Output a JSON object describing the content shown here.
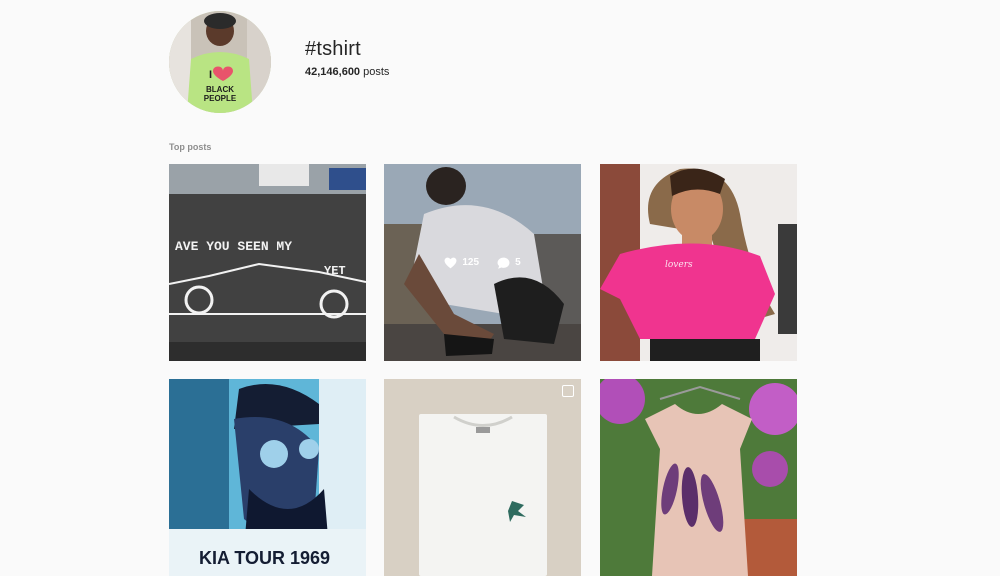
{
  "header": {
    "hashtag": "#tshirt",
    "post_count": "42,146,600",
    "post_count_suffix": " posts"
  },
  "avatar": {
    "shirt_text_1": "I",
    "shirt_text_2": "BLACK",
    "shirt_text_3": "PEOPLE"
  },
  "sections": {
    "top_posts": "Top posts"
  },
  "posts": [
    {
      "caption_art": [
        "AVE YOU SEEN MY",
        "YET"
      ]
    },
    {
      "likes": "125",
      "comments": "5"
    },
    {
      "shirt_script": "lovers"
    },
    {
      "shirt_text": "KIA TOUR 1969"
    },
    {},
    {}
  ],
  "colors": {
    "background": "#fafafa",
    "muted": "#8e8e8e",
    "text": "#262626",
    "pink_shirt": "#f0348f"
  },
  "icons": [
    "heart-icon",
    "comment-icon",
    "multi-image-icon"
  ]
}
